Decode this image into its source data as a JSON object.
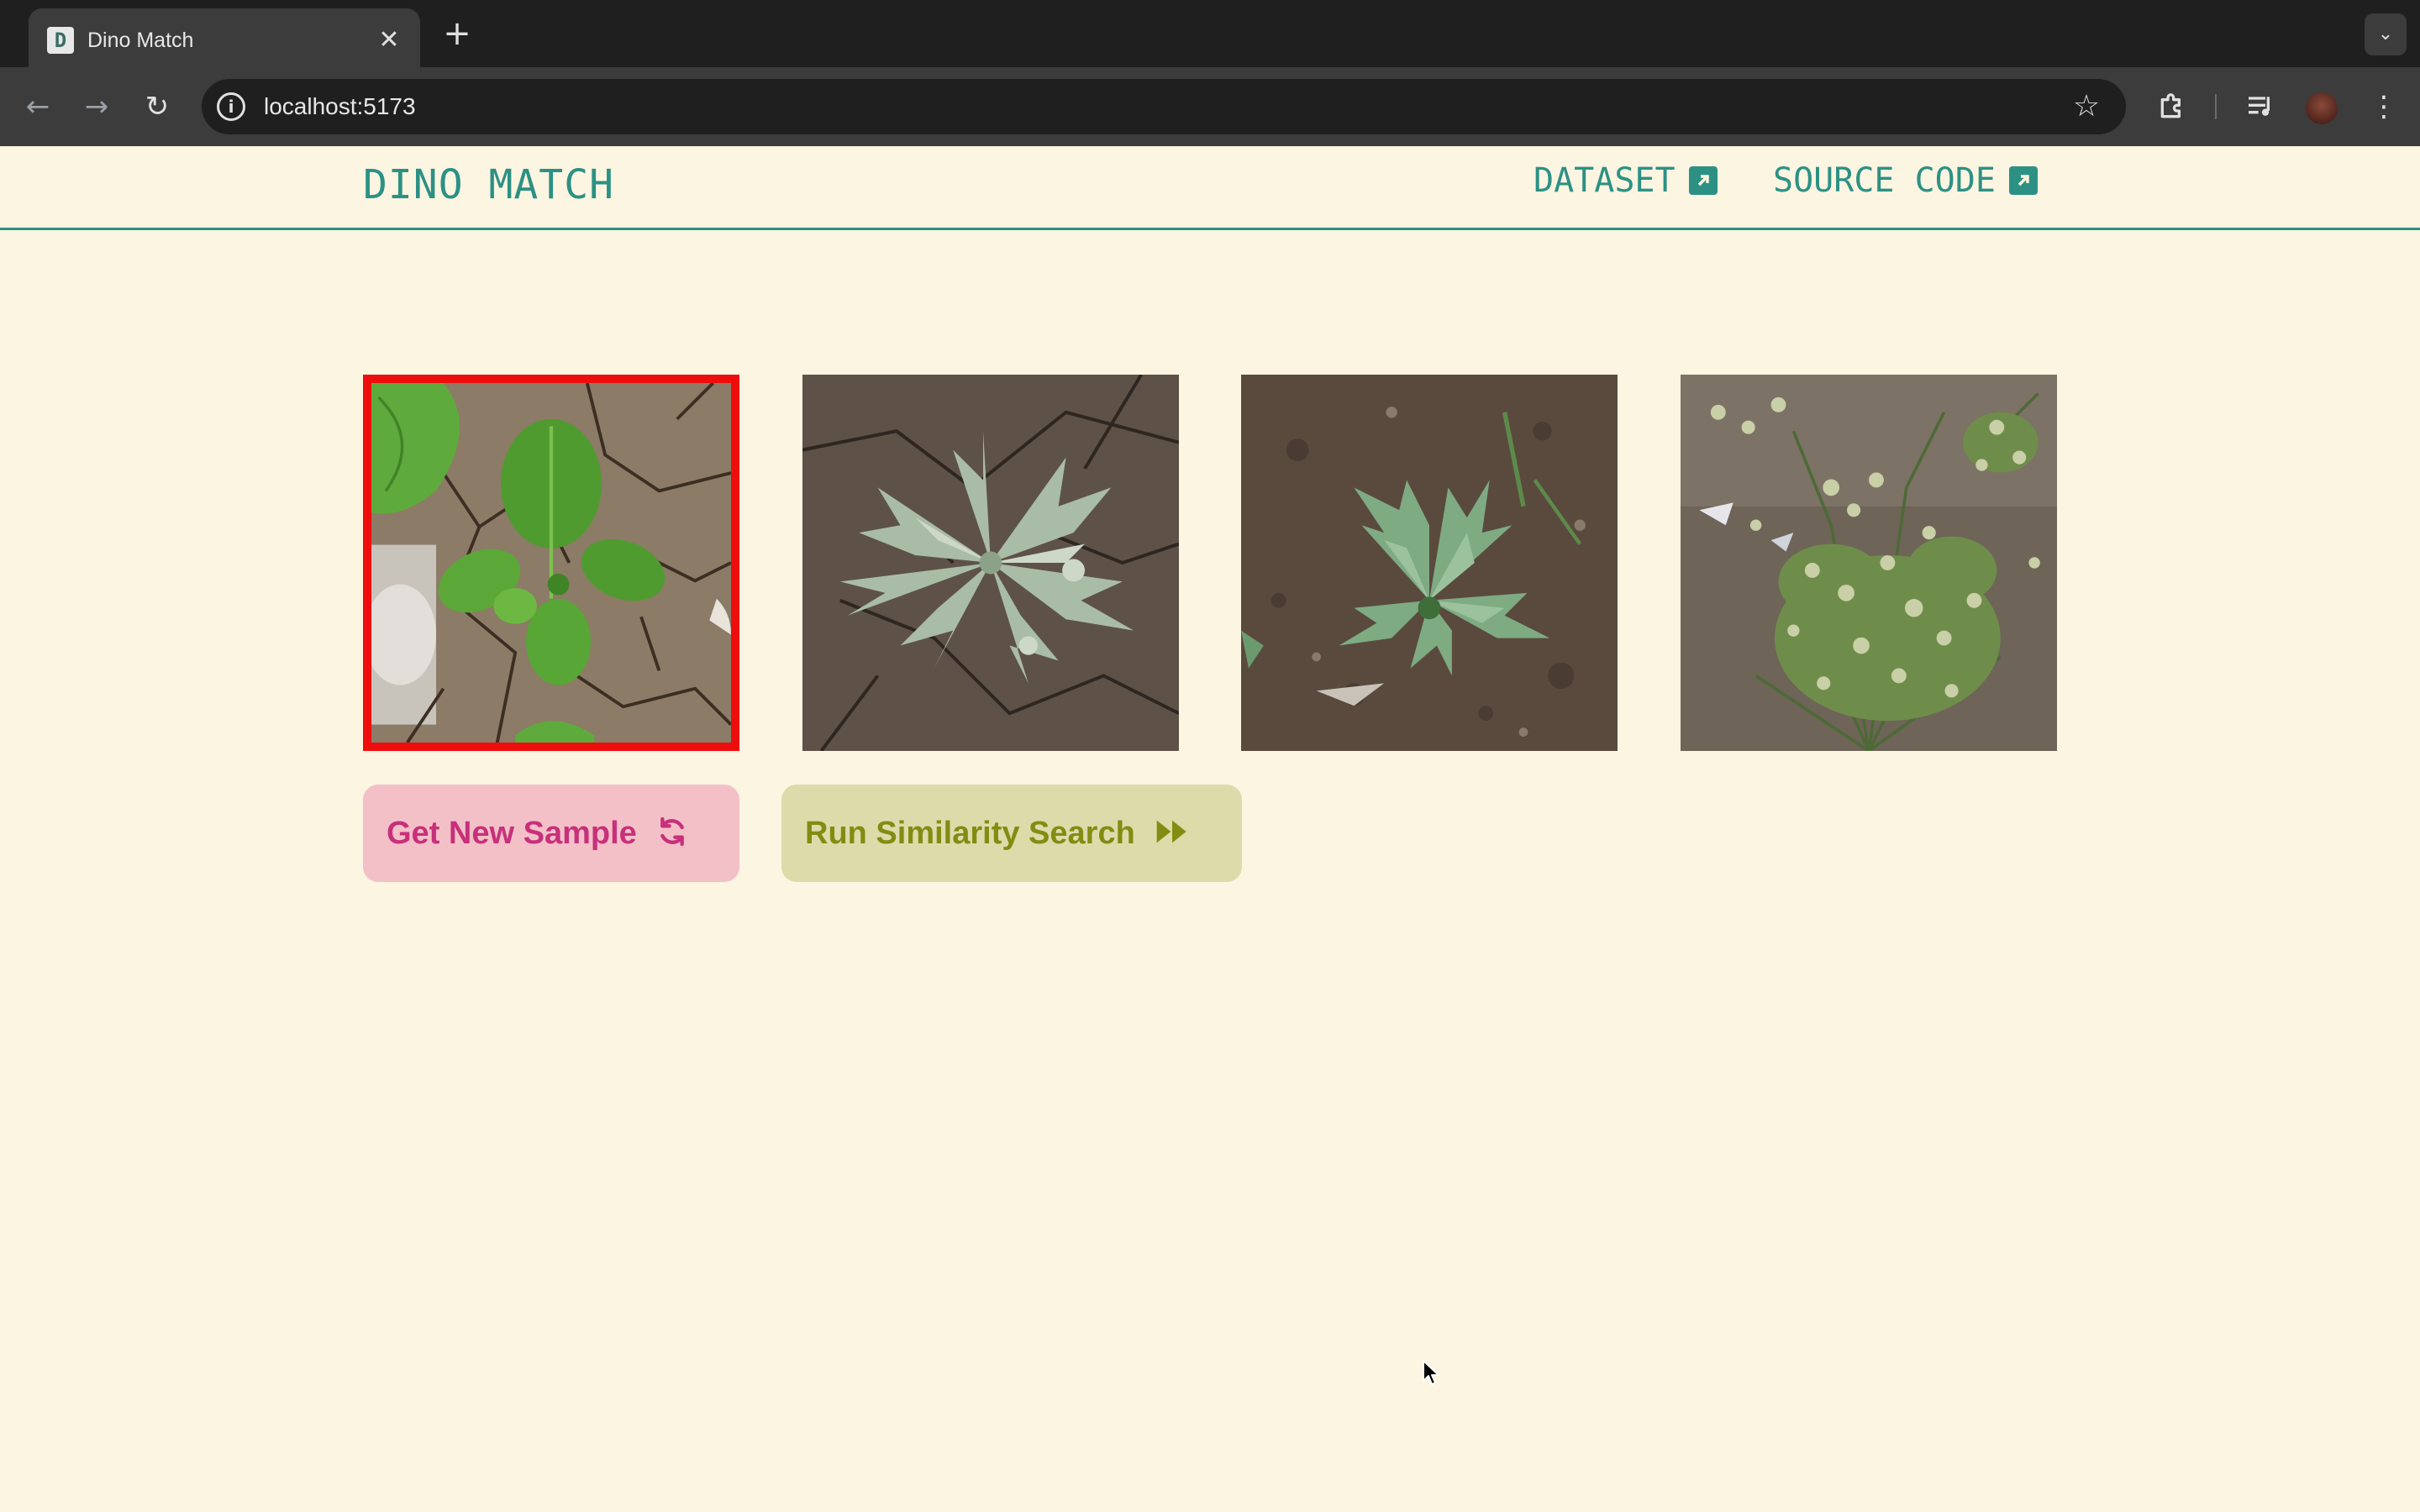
{
  "browser": {
    "tab_title": "Dino Match",
    "tab_favicon_letter": "D",
    "url": "localhost:5173"
  },
  "site": {
    "logo": "DINO MATCH",
    "nav": [
      {
        "label": "DATASET",
        "icon": "external-link-icon"
      },
      {
        "label": "SOURCE CODE",
        "icon": "external-link-icon"
      }
    ]
  },
  "gallery": {
    "selected_index": 0,
    "items": [
      {
        "subject": "potato seedling on cracked dry soil",
        "selected": true
      },
      {
        "subject": "pale weed on cracked soil",
        "selected": false
      },
      {
        "subject": "watermelon seedling on dark soil",
        "selected": false
      },
      {
        "subject": "flowering weed clump",
        "selected": false
      }
    ]
  },
  "actions": {
    "get_sample_label": "Get New Sample",
    "get_sample_icon": "refresh-icon",
    "search_label": "Run Similarity Search",
    "search_icon": "fast-forward-icon"
  },
  "colors": {
    "page_bg": "#fbf5e1",
    "accent": "#2c9184",
    "selected_border": "#ee0d0d",
    "sample_btn_bg": "#f4c0c8",
    "sample_btn_text": "#c7307a",
    "search_btn_bg": "#dedbab",
    "search_btn_text": "#838c12"
  }
}
